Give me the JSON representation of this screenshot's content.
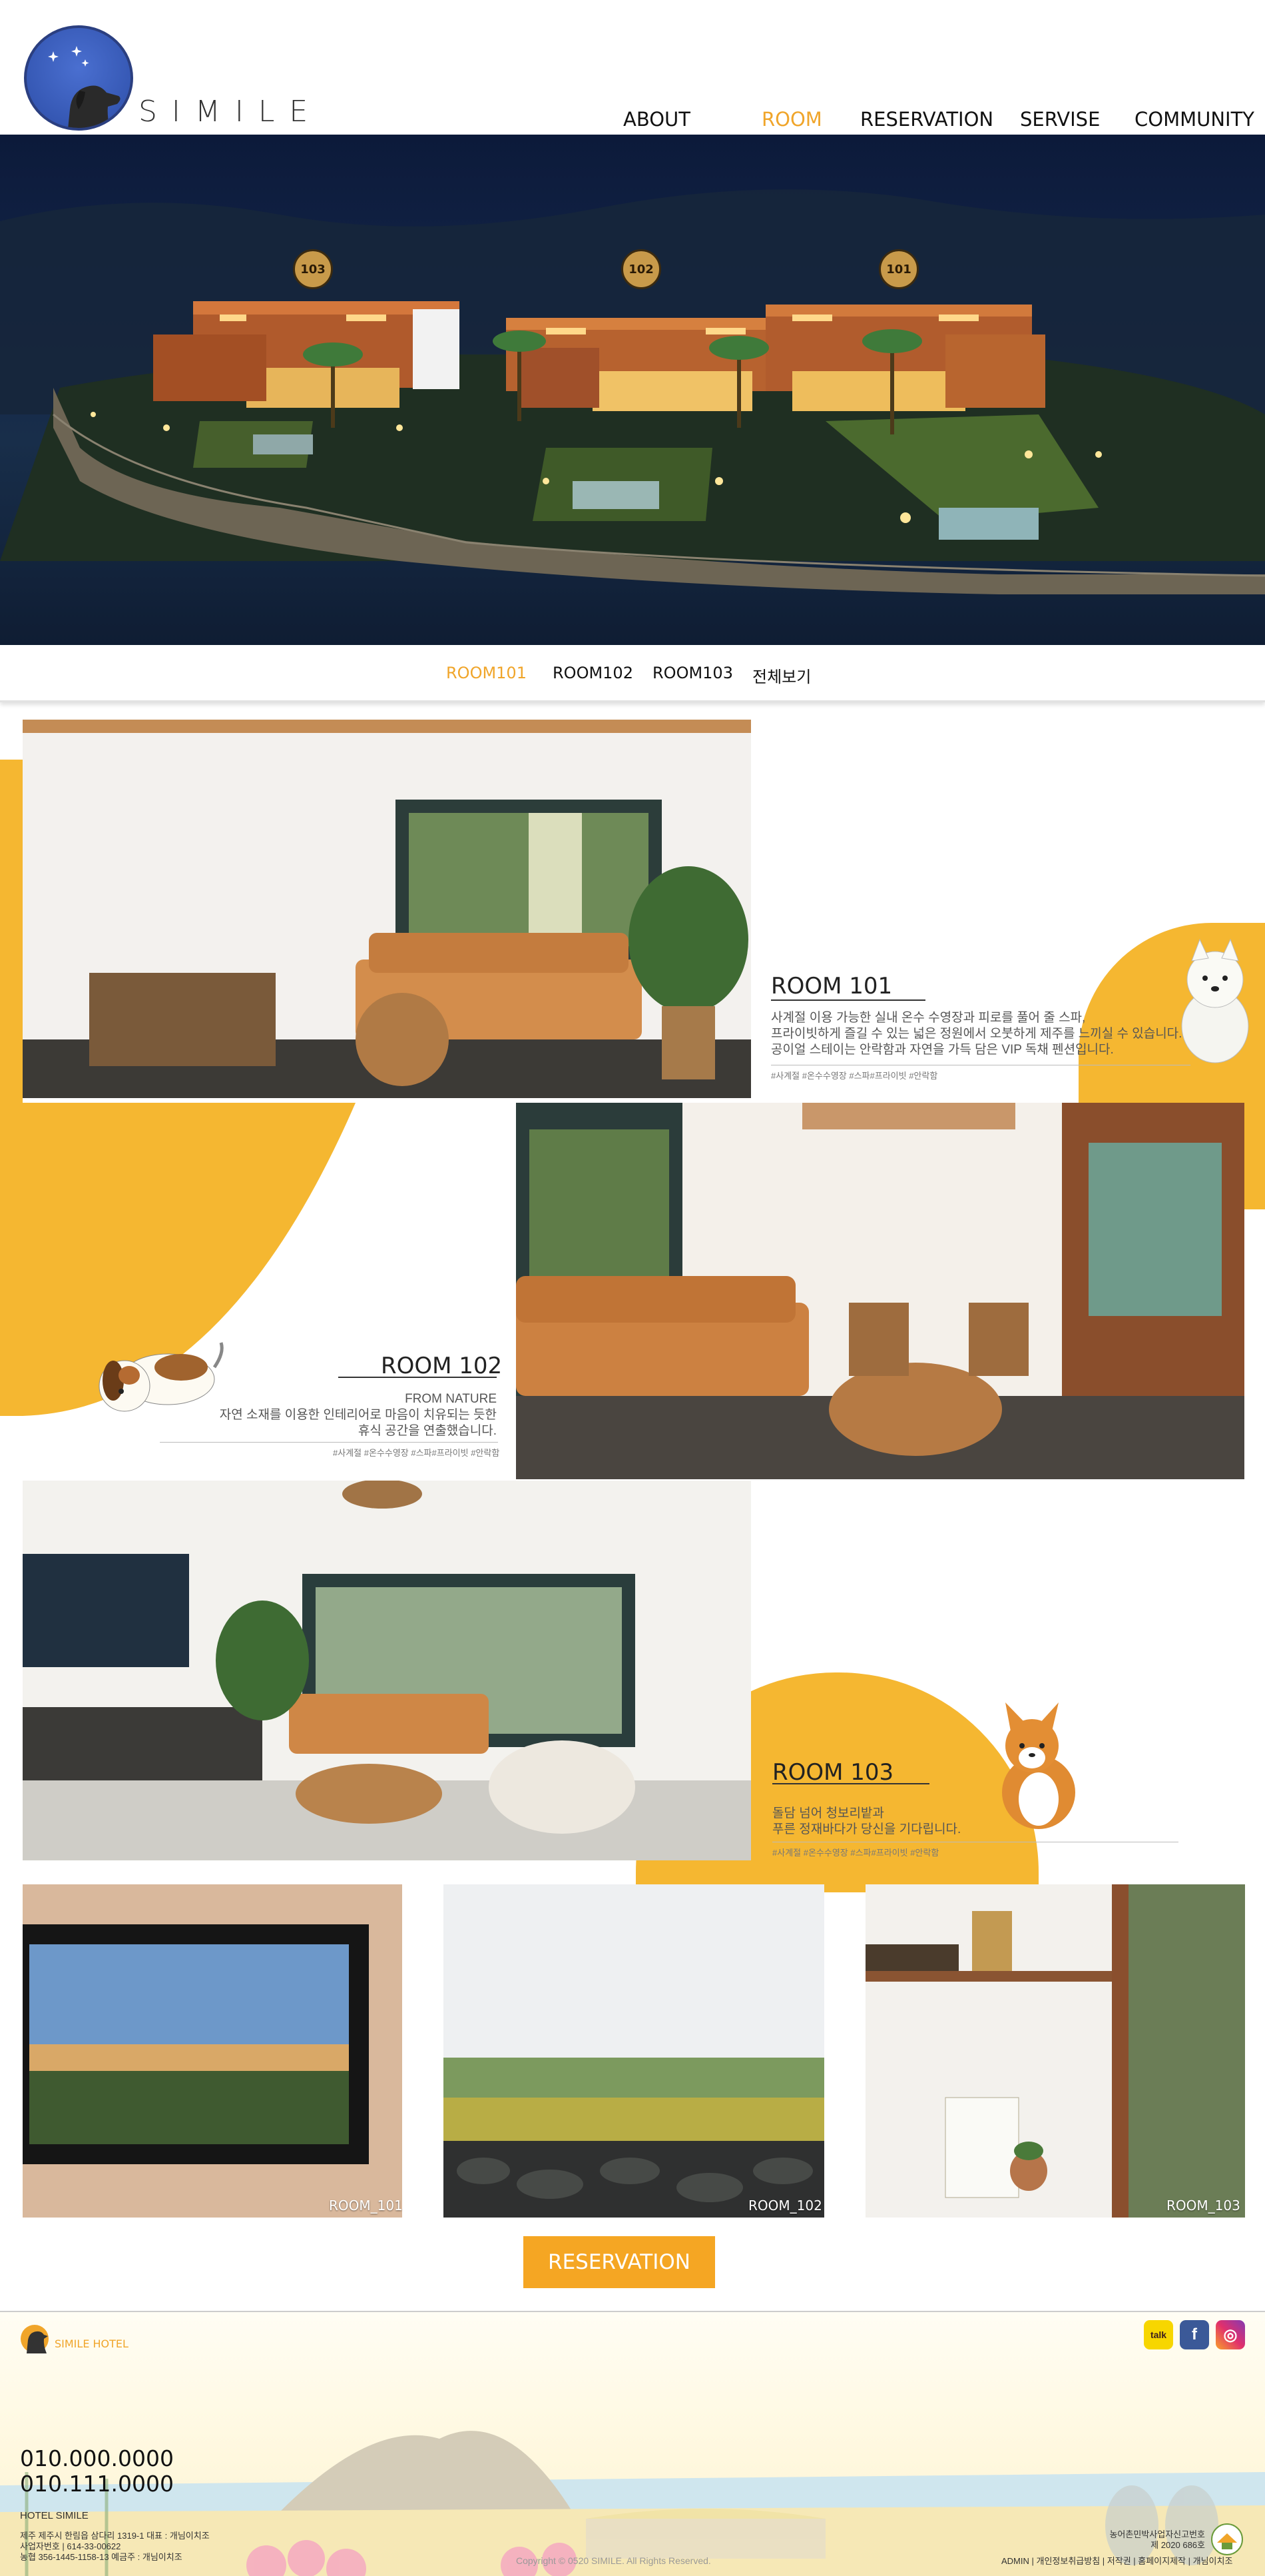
{
  "header": {
    "logo_text": "SIMILE",
    "nav": [
      {
        "label": "ABOUT",
        "active": false
      },
      {
        "label": "ROOM",
        "active": true
      },
      {
        "label": "RESERVATION",
        "active": false
      },
      {
        "label": "SERVISE",
        "active": false
      },
      {
        "label": "COMMUNITY",
        "active": false
      }
    ],
    "accent_color": "#f0a52a"
  },
  "hero": {
    "badges": [
      "103",
      "102",
      "101"
    ]
  },
  "room_tabs": [
    {
      "label": "ROOM101",
      "active": true
    },
    {
      "label": "ROOM102",
      "active": false
    },
    {
      "label": "ROOM103",
      "active": false
    },
    {
      "label": "전체보기",
      "active": false
    }
  ],
  "rooms": [
    {
      "title": "ROOM 101",
      "desc_lines": [
        "사계절 이용 가능한 실내 온수 수영장과 피로를 풀어 줄 스파,",
        "프라이빗하게 즐길 수 있는 넓은 정원에서 오붓하게 제주를 느끼실 수 있습니다.",
        "공이얼 스테이는 안락함과 자연을 가득 담은 VIP 독채 펜션입니다."
      ],
      "tags": "#사계절 #온수수영장 #스파#프라이빗 #안락함"
    },
    {
      "title": "ROOM 102",
      "subtitle": "FROM NATURE",
      "desc_lines": [
        "자연 소재를 이용한 인테리어로 마음이 치유되는 듯한",
        "휴식 공간을 연출했습니다."
      ],
      "tags": "#사계절 #온수수영장 #스파#프라이빗 #안락함"
    },
    {
      "title": "ROOM 103",
      "desc_lines": [
        "돌담 넘어 청보리밭과",
        "푸른 정재바다가 당신을 기다립니다."
      ],
      "tags": "#사계절 #온수수영장 #스파#프라이빗 #안락함"
    }
  ],
  "gallery": [
    {
      "label": "ROOM_101"
    },
    {
      "label": "ROOM_102"
    },
    {
      "label": "ROOM_103"
    }
  ],
  "reservation_button": "RESERVATION",
  "footer": {
    "logo_text": "SIMILE HOTEL",
    "phones": [
      "010.000.0000",
      "010.111.0000"
    ],
    "company_title": "HOTEL SIMILE",
    "address_lines": [
      "제주 제주시 한림읍 삼다리 1319-1 대표 : 개님이치조",
      "사업자번호 | 614-33-00622",
      "농협 356-1445-1158-13 예금주 : 개님이치조"
    ],
    "copyright": "Copyright © 0520 SIMILE. All Rights Reserved.",
    "license_lines": [
      "농어촌민박사업자신고번호",
      "제 2020 686호"
    ],
    "links": "ADMIN | 개인정보취급방침 | 저작권 | 홈페이지제작 | 개님이치조",
    "sns": [
      "kakao",
      "facebook",
      "instagram"
    ]
  }
}
